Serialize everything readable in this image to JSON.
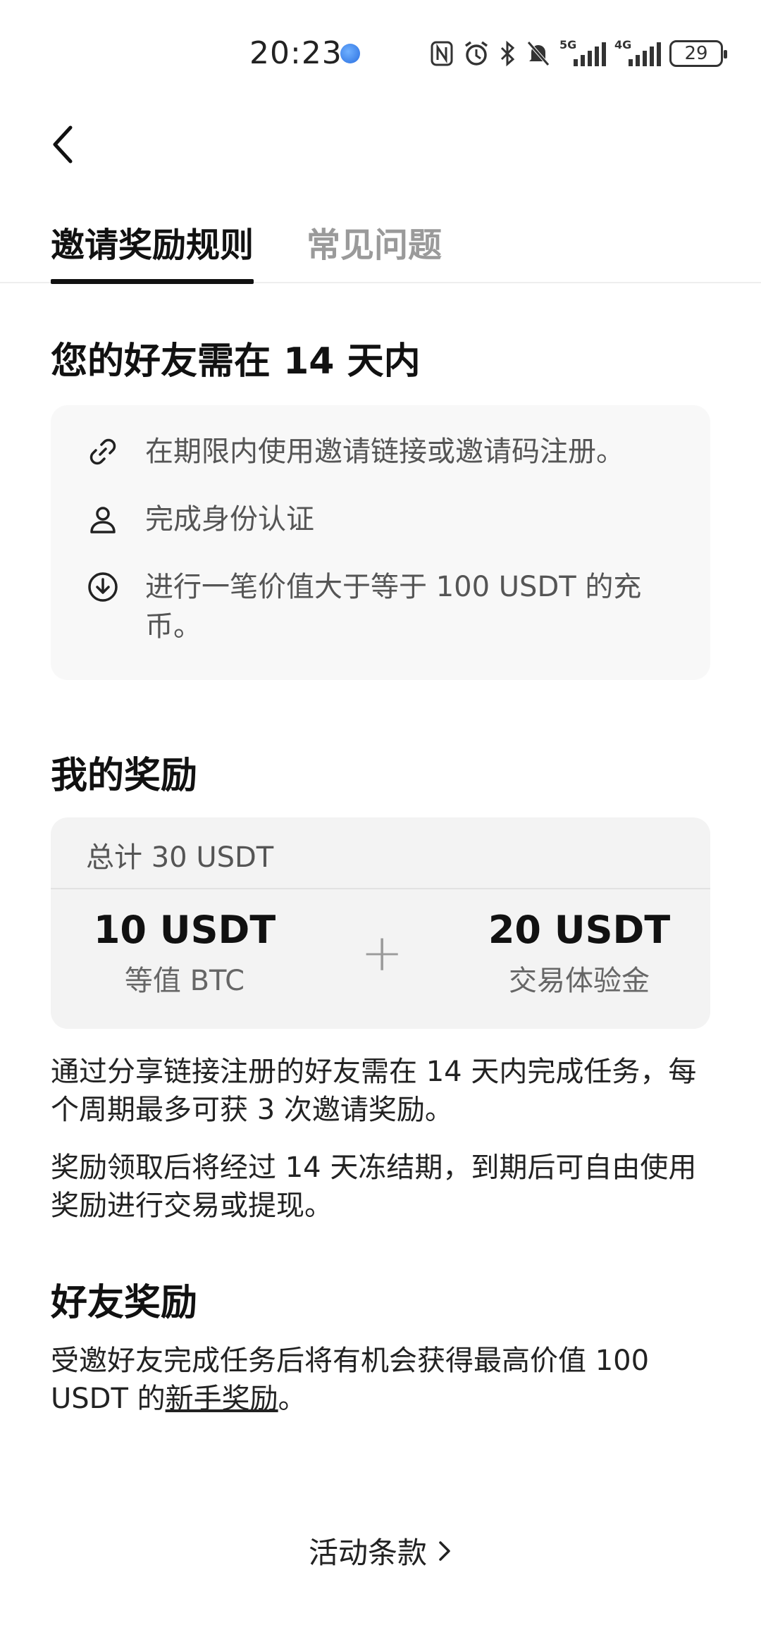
{
  "status_bar": {
    "time": "20:23",
    "signal_5g": "5G",
    "signal_4g": "4G",
    "battery": "29"
  },
  "tabs": [
    {
      "label": "邀请奖励规则",
      "active": true
    },
    {
      "label": "常见问题",
      "active": false
    }
  ],
  "requirements": {
    "title": "您的好友需在 14 天内",
    "items": [
      {
        "icon": "link-icon",
        "text": "在期限内使用邀请链接或邀请码注册。"
      },
      {
        "icon": "user-icon",
        "text": "完成身份认证"
      },
      {
        "icon": "deposit-icon",
        "text": "进行一笔价值大于等于 100 USDT 的充币。"
      }
    ]
  },
  "my_reward": {
    "title": "我的奖励",
    "total": "总计 30 USDT",
    "left_amount": "10 USDT",
    "left_sub": "等值 BTC",
    "plus": "+",
    "right_amount": "20 USDT",
    "right_sub": "交易体验金",
    "note1": "通过分享链接注册的好友需在 14 天内完成任务，每个周期最多可获 3 次邀请奖励。",
    "note2": "奖励领取后将经过 14 天冻结期，到期后可自由使用奖励进行交易或提现。"
  },
  "friend_reward": {
    "title": "好友奖励",
    "text_prefix": "受邀好友完成任务后将有机会获得最高价值 100 USDT 的",
    "link_text": "新手奖励",
    "text_suffix": "。"
  },
  "footer": {
    "terms_label": "活动条款"
  }
}
